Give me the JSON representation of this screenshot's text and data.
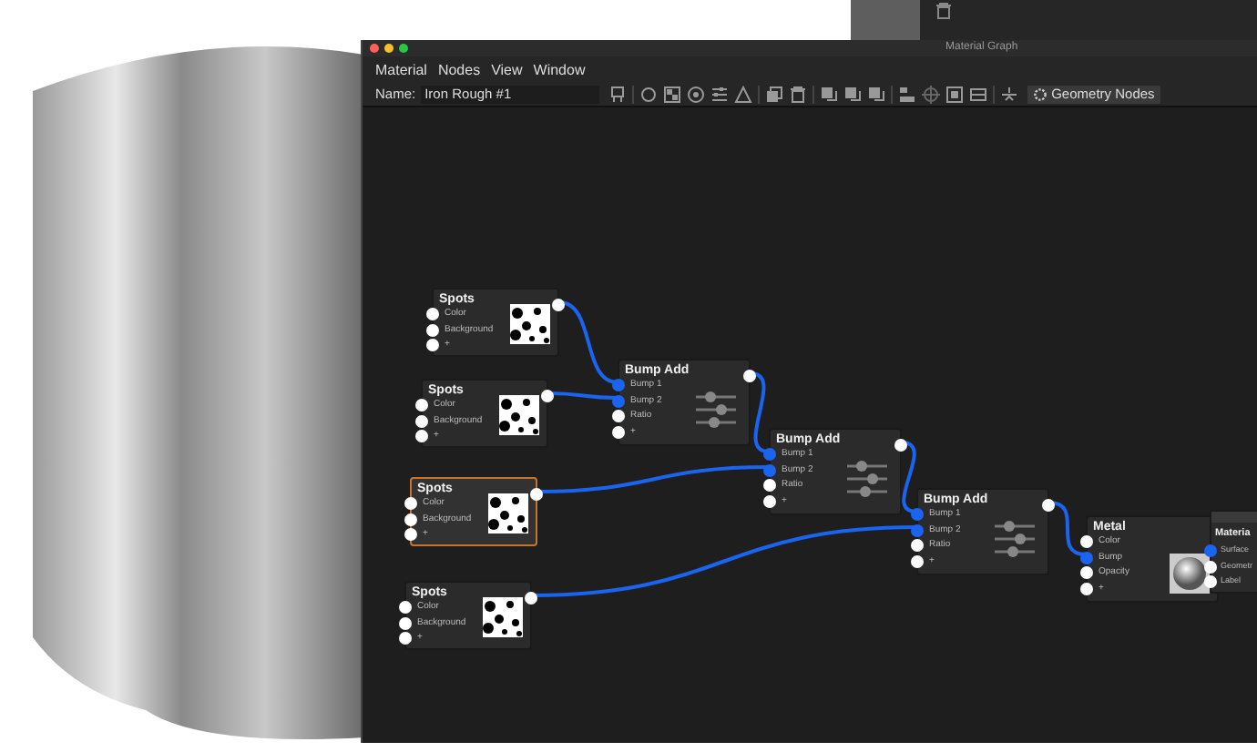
{
  "window": {
    "title": "Material Graph"
  },
  "menu": [
    "Material",
    "Nodes",
    "View",
    "Window"
  ],
  "toolbar": {
    "name_label": "Name:",
    "name_value": "Iron Rough #1",
    "mode_button": "Geometry Nodes"
  },
  "nodes": [
    {
      "kind": "spots",
      "title": "Spots",
      "selected": false,
      "ports": [
        {
          "label": "Color",
          "connected": false
        },
        {
          "label": "Background",
          "connected": false
        },
        {
          "label": "+",
          "connected": false
        }
      ]
    },
    {
      "kind": "spots",
      "title": "Spots",
      "selected": false,
      "ports": [
        {
          "label": "Color",
          "connected": false
        },
        {
          "label": "Background",
          "connected": false
        },
        {
          "label": "+",
          "connected": false
        }
      ]
    },
    {
      "kind": "spots",
      "title": "Spots",
      "selected": true,
      "ports": [
        {
          "label": "Color",
          "connected": false
        },
        {
          "label": "Background",
          "connected": false
        },
        {
          "label": "+",
          "connected": false
        }
      ]
    },
    {
      "kind": "spots",
      "title": "Spots",
      "selected": false,
      "ports": [
        {
          "label": "Color",
          "connected": false
        },
        {
          "label": "Background",
          "connected": false
        },
        {
          "label": "+",
          "connected": false
        }
      ]
    },
    {
      "kind": "bump",
      "title": "Bump Add",
      "selected": false,
      "ports": [
        {
          "label": "Bump 1",
          "connected": true
        },
        {
          "label": "Bump 2",
          "connected": true
        },
        {
          "label": "Ratio",
          "connected": false
        },
        {
          "label": "+",
          "connected": false
        }
      ]
    },
    {
      "kind": "bump",
      "title": "Bump Add",
      "selected": false,
      "ports": [
        {
          "label": "Bump 1",
          "connected": true
        },
        {
          "label": "Bump 2",
          "connected": true
        },
        {
          "label": "Ratio",
          "connected": false
        },
        {
          "label": "+",
          "connected": false
        }
      ]
    },
    {
      "kind": "bump",
      "title": "Bump Add",
      "selected": false,
      "ports": [
        {
          "label": "Bump 1",
          "connected": true
        },
        {
          "label": "Bump 2",
          "connected": true
        },
        {
          "label": "Ratio",
          "connected": false
        },
        {
          "label": "+",
          "connected": false
        }
      ]
    },
    {
      "kind": "metal",
      "title": "Metal",
      "selected": false,
      "ports": [
        {
          "label": "Color",
          "connected": false
        },
        {
          "label": "Bump",
          "connected": true
        },
        {
          "label": "Opacity",
          "connected": false
        },
        {
          "label": "+",
          "connected": false
        }
      ]
    },
    {
      "kind": "output",
      "title": "Materia",
      "selected": false,
      "ports": [
        {
          "label": "Surface",
          "connected": true
        },
        {
          "label": "Geometr",
          "connected": false
        },
        {
          "label": "Label",
          "connected": false
        }
      ]
    }
  ]
}
